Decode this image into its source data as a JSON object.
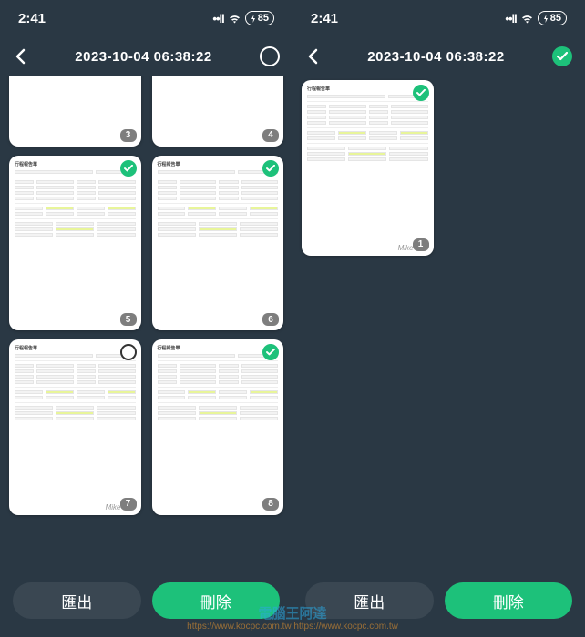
{
  "status": {
    "time": "2:41",
    "signal": "••ll",
    "wifi": "wifi-icon",
    "battery_pct": "85"
  },
  "header": {
    "title": "2023-10-04 06:38:22"
  },
  "left_screen": {
    "select_all_checked": false,
    "cards": [
      {
        "index": "3",
        "checked": false,
        "top_hidden": true,
        "watermark": ""
      },
      {
        "index": "4",
        "checked": false,
        "top_hidden": true,
        "watermark": ""
      },
      {
        "index": "5",
        "checked": true,
        "top_hidden": false,
        "watermark": ""
      },
      {
        "index": "6",
        "checked": true,
        "top_hidden": false,
        "watermark": ""
      },
      {
        "index": "7",
        "checked": false,
        "top_hidden": false,
        "watermark": "Mike"
      },
      {
        "index": "8",
        "checked": true,
        "top_hidden": false,
        "watermark": ""
      }
    ]
  },
  "right_screen": {
    "select_all_checked": true,
    "cards": [
      {
        "index": "1",
        "checked": true,
        "top_hidden": false,
        "watermark": "Mike"
      }
    ]
  },
  "buttons": {
    "export": "匯出",
    "delete": "刪除"
  },
  "global_watermark": {
    "line1": "電腦王阿達",
    "line2": "https://www.kocpc.com.tw  https://www.kocpc.com.tw"
  },
  "doc_preview_title": "行程報告單"
}
